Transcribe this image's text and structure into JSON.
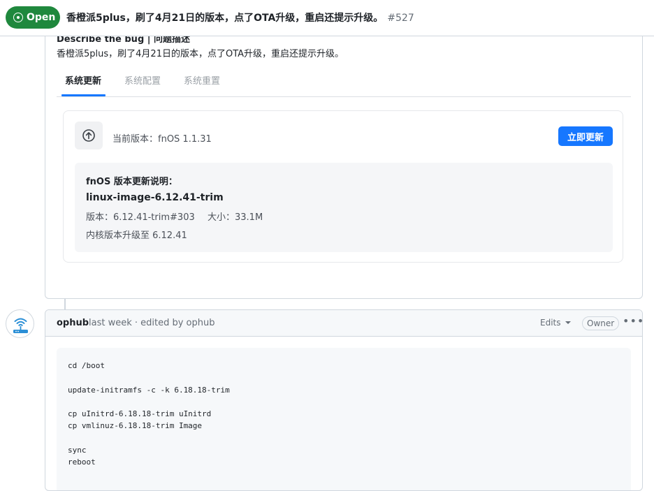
{
  "issue": {
    "state": "Open",
    "title": "香橙派5plus，刷了4月21日的版本，点了OTA升级，重启还提示升级。",
    "number": "#527"
  },
  "comment1": {
    "heading": "Describe the bug | 问题描述",
    "text": "香橙派5plus，刷了4月21日的版本，点了OTA升级，重启还提示升级。",
    "screenshot": {
      "tabs": [
        "系统更新",
        "系统配置",
        "系统重置"
      ],
      "active_tab": "系统更新",
      "current_version": "当前版本：fnOS 1.1.31",
      "update_button": "立即更新",
      "notes_title": "fnOS 版本更新说明：",
      "package": "linux-image-6.12.41-trim",
      "version_line": "版本：6.12.41-trim#303",
      "size_line": "大小：33.1M",
      "kernel_line": "内核版本升级至 6.12.41",
      "accent_color": "#1677ff"
    }
  },
  "comment2": {
    "author": "ophub",
    "meta": "last week · edited by ophub",
    "edits_label": "Edits",
    "owner_badge": "Owner",
    "more_icon": "kebab-horizontal-icon",
    "avatar_icon": "wifi-router-icon",
    "code": "cd /boot\n\nupdate-initramfs -c -k 6.18.18-trim\n\ncp uInitrd-6.18.18-trim uInitrd\ncp vmlinuz-6.18.18-trim Image\n\nsync\nreboot"
  },
  "colors": {
    "open_green": "#1f883d",
    "border": "#d0d7de",
    "muted_text": "#656d76"
  }
}
